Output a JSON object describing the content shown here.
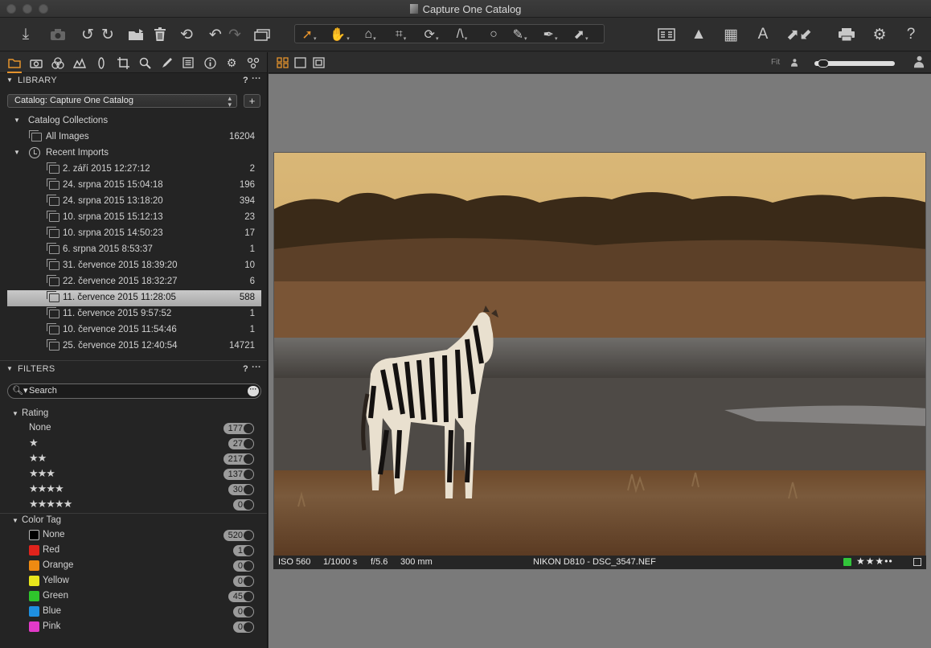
{
  "window": {
    "title": "Capture One Catalog"
  },
  "toolbar": {
    "left_icons": [
      "import-icon",
      "camera-icon",
      "rotate-left-icon",
      "rotate-right-icon",
      "move-to-folder-icon",
      "trash-icon",
      "undo-all-icon",
      "undo-icon",
      "redo-icon",
      "stack-icon"
    ],
    "cursor_tools": [
      "select-cursor-icon",
      "pan-icon",
      "loupe-icon",
      "crop-icon",
      "rotate-tool-icon",
      "keystone-icon",
      "spot-removal-icon",
      "brush-icon",
      "color-picker-icon",
      "copy-apply-icon"
    ],
    "right_icons": [
      "compare-icon",
      "exposure-warning-icon",
      "grid-icon",
      "text-overlay-icon",
      "copy-adjustments-icon",
      "print-icon",
      "settings-icon",
      "help-icon"
    ]
  },
  "tool_tabs": [
    "library-tab",
    "capture-tab",
    "color-tab",
    "exposure-tab",
    "lens-tab",
    "crop-tab",
    "details-tab",
    "local-adjust-tab",
    "adjustments-tab",
    "metadata-tab",
    "output-tab",
    "batch-tab"
  ],
  "library": {
    "header": "LIBRARY",
    "help": "?",
    "more": "···",
    "catalog_select": "Catalog: Capture One Catalog",
    "add_label": "+",
    "catalog_collections": "Catalog Collections",
    "all_images": {
      "label": "All Images",
      "count": "16204"
    },
    "recent_imports": "Recent Imports",
    "imports": [
      {
        "label": "2. září 2015 12:27:12",
        "count": "2"
      },
      {
        "label": "24. srpna 2015 15:04:18",
        "count": "196"
      },
      {
        "label": "24. srpna 2015 13:18:20",
        "count": "394"
      },
      {
        "label": "10. srpna 2015 15:12:13",
        "count": "23"
      },
      {
        "label": "10. srpna 2015 14:50:23",
        "count": "17"
      },
      {
        "label": "6. srpna 2015 8:53:37",
        "count": "1"
      },
      {
        "label": "31. července 2015 18:39:20",
        "count": "10"
      },
      {
        "label": "22. července 2015 18:32:27",
        "count": "6"
      },
      {
        "label": "11. července 2015 11:28:05",
        "count": "588"
      },
      {
        "label": "11. července 2015 9:57:52",
        "count": "1"
      },
      {
        "label": "10. července 2015 11:54:46",
        "count": "1"
      },
      {
        "label": "25. července 2015 12:40:54",
        "count": "14721"
      }
    ],
    "selected_index": 8
  },
  "filters": {
    "header": "FILTERS",
    "help": "?",
    "more": "···",
    "search_placeholder": "Search",
    "rating_label": "Rating",
    "ratings": [
      {
        "label": "None",
        "count": "177"
      },
      {
        "label": "★",
        "count": "27"
      },
      {
        "label": "★★",
        "count": "217"
      },
      {
        "label": "★★★",
        "count": "137"
      },
      {
        "label": "★★★★",
        "count": "30"
      },
      {
        "label": "★★★★★",
        "count": "0"
      }
    ],
    "color_tag_label": "Color Tag",
    "color_tags": [
      {
        "label": "None",
        "count": "520",
        "color": "#000000"
      },
      {
        "label": "Red",
        "count": "1",
        "color": "#e0231c"
      },
      {
        "label": "Orange",
        "count": "0",
        "color": "#ee8a12"
      },
      {
        "label": "Yellow",
        "count": "0",
        "color": "#e8e51c"
      },
      {
        "label": "Green",
        "count": "45",
        "color": "#2fc52c"
      },
      {
        "label": "Blue",
        "count": "0",
        "color": "#1e8fe0"
      },
      {
        "label": "Pink",
        "count": "0",
        "color": "#e23ac8"
      }
    ]
  },
  "viewer": {
    "fit_label": "Fit",
    "zoom_fraction": 0.05,
    "info": {
      "iso": "ISO 560",
      "shutter": "1/1000 s",
      "aperture": "f/5.6",
      "focal": "300 mm",
      "filename": "NIKON D810 - DSC_3547.NEF",
      "rating_stars": "★★★••",
      "color_tag": "#31c53a"
    }
  },
  "colors": {
    "accent": "#e5932d",
    "panel": "#242424",
    "viewer_bg": "#7a7a7a"
  }
}
